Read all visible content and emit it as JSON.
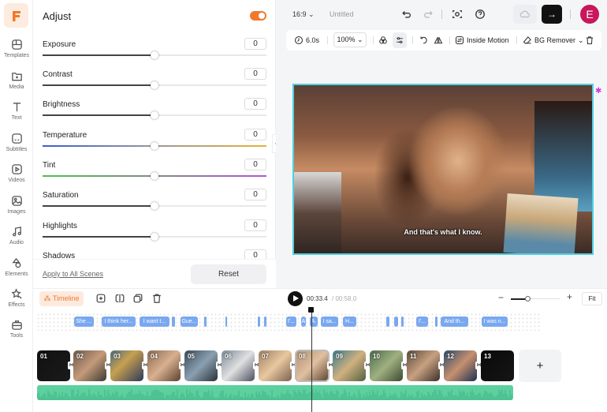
{
  "rail": {
    "logo_letter": "F",
    "items": [
      {
        "label": "Templates",
        "icon": "templates-icon"
      },
      {
        "label": "Media",
        "icon": "media-icon"
      },
      {
        "label": "Text",
        "icon": "text-icon"
      },
      {
        "label": "Subtitles",
        "icon": "subtitles-icon"
      },
      {
        "label": "Videos",
        "icon": "videos-icon"
      },
      {
        "label": "Images",
        "icon": "images-icon"
      },
      {
        "label": "Audio",
        "icon": "audio-icon"
      },
      {
        "label": "Elements",
        "icon": "elements-icon"
      },
      {
        "label": "Effects",
        "icon": "effects-icon"
      },
      {
        "label": "Tools",
        "icon": "tools-icon"
      }
    ]
  },
  "panel": {
    "title": "Adjust",
    "enabled": true,
    "accent": "#f07a2a",
    "sliders": [
      {
        "label": "Exposure",
        "value": "0",
        "position": 0.5
      },
      {
        "label": "Contrast",
        "value": "0",
        "position": 0.5
      },
      {
        "label": "Brightness",
        "value": "0",
        "position": 0.5
      },
      {
        "label": "Temperature",
        "value": "0",
        "position": 0.5
      },
      {
        "label": "Tint",
        "value": "0",
        "position": 0.5
      },
      {
        "label": "Saturation",
        "value": "0",
        "position": 0.5
      },
      {
        "label": "Highlights",
        "value": "0",
        "position": 0.5
      },
      {
        "label": "Shadows",
        "value": "0",
        "position": 0.5
      }
    ],
    "apply_all": "Apply to All Scenes",
    "reset": "Reset"
  },
  "topbar": {
    "ratio": "16:9",
    "title": "Untitled",
    "export_arrow": "→",
    "avatar_letter": "E"
  },
  "toolbar": {
    "duration": "6.0s",
    "zoom": "100%",
    "inside_motion": "Inside Motion",
    "bg_remover": "BG Remover"
  },
  "canvas": {
    "subtitle": "And that's what I know."
  },
  "timeline": {
    "tab": "Timeline",
    "current_time": "00:33.4",
    "total_time": "/ 00:58.0",
    "fit": "Fit",
    "zoom_level": 0.3,
    "subtitles": [
      "She ...",
      "I think her...",
      "I want t...",
      "",
      "Gue...",
      "",
      "",
      "",
      "",
      "I'...",
      "A",
      "A.",
      "I sa...",
      "H...",
      "",
      "",
      "",
      "I'...",
      "",
      "And th...",
      "I was n..."
    ],
    "clips": [
      "01",
      "02",
      "03",
      "04",
      "05",
      "06",
      "07",
      "08",
      "09",
      "10",
      "11",
      "12",
      "13"
    ],
    "selected_clip": "08",
    "add": "+"
  }
}
